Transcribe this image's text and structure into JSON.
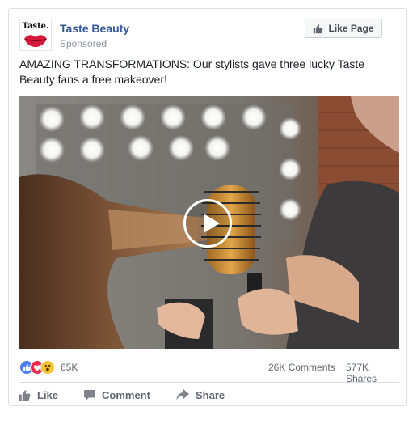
{
  "post": {
    "page_name": "Taste Beauty",
    "sponsored_label": "Sponsored",
    "logo_text": "Taste.",
    "like_page_label": "Like Page",
    "caption": "AMAZING TRANSFORMATIONS: Our stylists gave three lucky Taste Beauty fans a free makeover!"
  },
  "media": {
    "type": "video",
    "play_icon": "play-icon"
  },
  "stats": {
    "reactions": [
      "like",
      "love",
      "wow"
    ],
    "reaction_count": "65K",
    "comments": "26K Comments",
    "shares": "577K Shares"
  },
  "actions": {
    "like": "Like",
    "comment": "Comment",
    "share": "Share"
  },
  "colors": {
    "link_blue": "#365899",
    "muted_text": "#90949c",
    "action_text": "#606770",
    "like_blue": "#4a7cf0",
    "love_red": "#f0284a",
    "wow_yellow": "#f7c230"
  }
}
